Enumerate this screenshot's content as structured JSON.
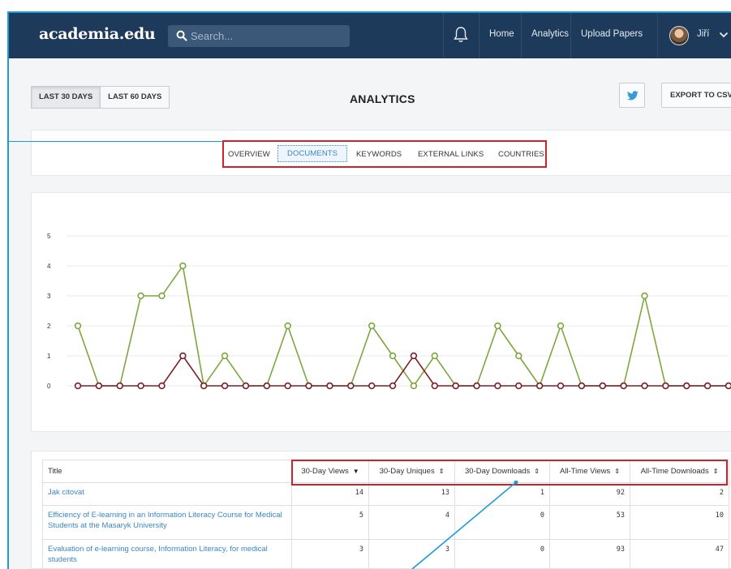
{
  "navbar": {
    "logo": "academia.edu",
    "search_placeholder": "Search...",
    "links": [
      "Home",
      "Analytics",
      "Upload Papers"
    ],
    "user_name": "Jiří"
  },
  "toolbar": {
    "range_buttons": [
      "LAST 30 DAYS",
      "LAST 60 DAYS"
    ],
    "active_range": "LAST 30 DAYS",
    "title": "ANALYTICS",
    "export_label": "EXPORT TO CSV"
  },
  "tabs": {
    "items": [
      "OVERVIEW",
      "DOCUMENTS",
      "KEYWORDS",
      "EXTERNAL LINKS",
      "COUNTRIES"
    ],
    "active": "DOCUMENTS"
  },
  "chart_data": {
    "type": "line",
    "x": [
      1,
      2,
      3,
      4,
      5,
      6,
      7,
      8,
      9,
      10,
      11,
      12,
      13,
      14,
      15,
      16,
      17,
      18,
      19,
      20,
      21,
      22,
      23,
      24,
      25,
      26,
      27,
      28,
      29,
      30,
      31,
      32
    ],
    "yticks": [
      0,
      1,
      2,
      3,
      4,
      5
    ],
    "ylim": [
      0,
      5
    ],
    "grid": true,
    "colors": {
      "views": "#7ea63e",
      "downloads": "#7a1f27",
      "gridline": "#e6e8eb"
    },
    "series": [
      {
        "values": [
          2,
          0,
          0,
          3,
          3,
          4,
          0,
          1,
          0,
          0,
          2,
          0,
          0,
          0,
          2,
          1,
          0,
          1,
          0,
          0,
          2,
          1,
          0,
          2,
          0,
          0,
          0,
          3,
          0,
          0,
          0,
          0
        ]
      },
      {
        "values": [
          0,
          0,
          0,
          0,
          0,
          1,
          0,
          0,
          0,
          0,
          0,
          0,
          0,
          0,
          0,
          0,
          1,
          0,
          0,
          0,
          0,
          0,
          0,
          0,
          0,
          0,
          0,
          0,
          0,
          0,
          0,
          0
        ]
      }
    ]
  },
  "table": {
    "title_header": "Title",
    "headers": [
      "30-Day Views",
      "30-Day Uniques",
      "30-Day Downloads",
      "All-Time Views",
      "All-Time Downloads"
    ],
    "header_sort_icons": [
      "caret-down-icon",
      "sort-icon",
      "sort-icon",
      "sort-icon",
      "sort-icon"
    ],
    "rows": [
      {
        "title": "Jak citovat",
        "values": [
          "14",
          "13",
          "1",
          "92",
          "2"
        ]
      },
      {
        "title": "Efficiency of E-learning in an Information Literacy Course for Medical Students at the Masaryk University",
        "values": [
          "5",
          "4",
          "0",
          "53",
          "10"
        ]
      },
      {
        "title": "Evaluation of e-learning course, Information Literacy, for medical students",
        "values": [
          "3",
          "3",
          "0",
          "93",
          "47"
        ]
      }
    ]
  },
  "annotation_color": "#d0202a",
  "pointer_color": "#1e9ad6"
}
